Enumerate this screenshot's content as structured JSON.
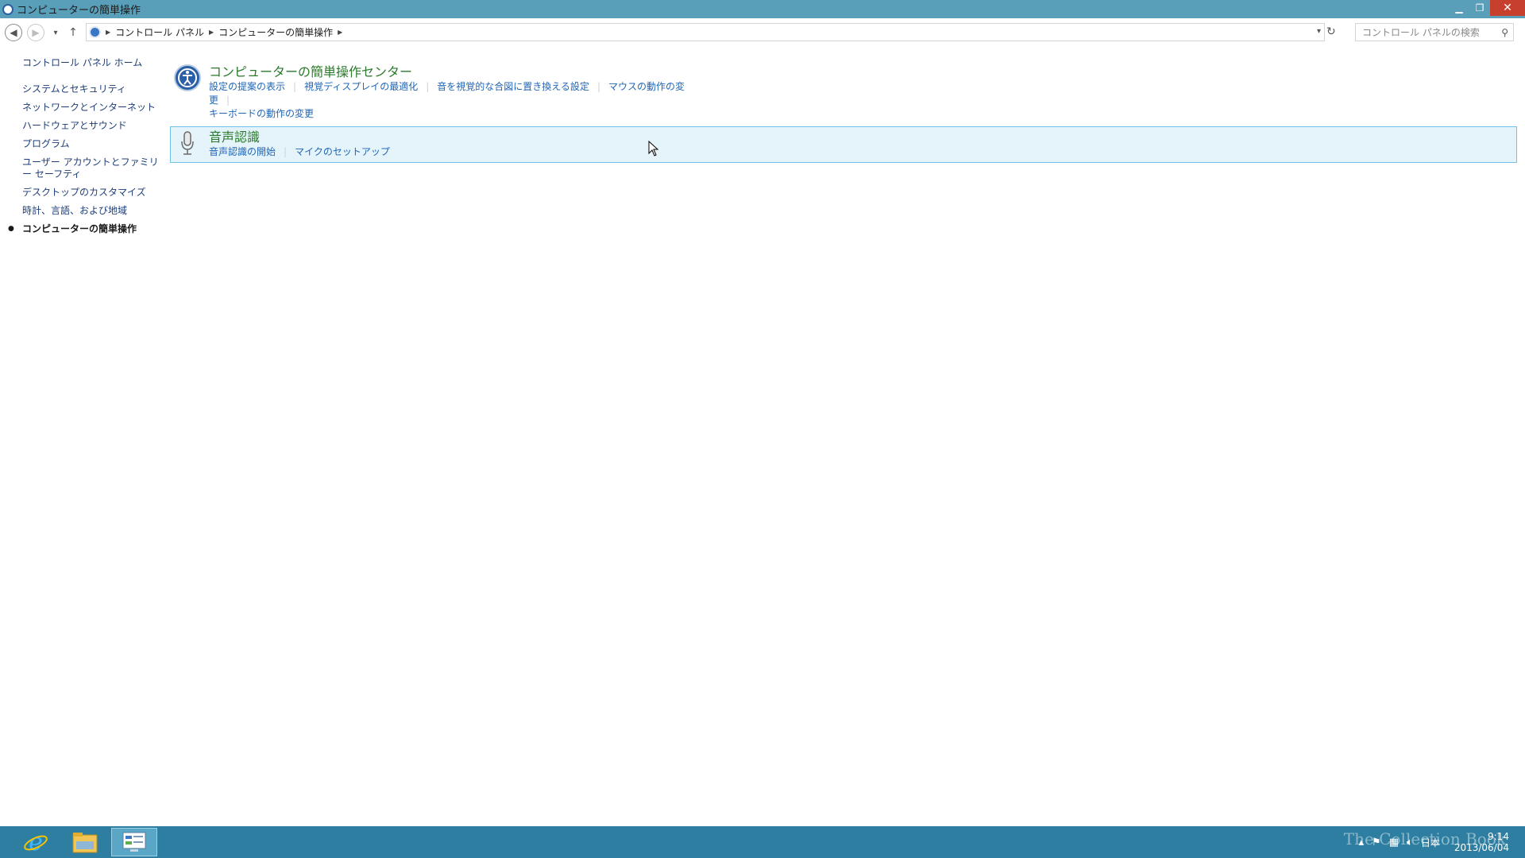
{
  "window": {
    "title": "コンピューターの簡単操作"
  },
  "address": {
    "crumbs": [
      "コントロール パネル",
      "コンピューターの簡単操作"
    ],
    "search_placeholder": "コントロール パネルの検索"
  },
  "sidebar": {
    "home": "コントロール パネル ホーム",
    "items": [
      "システムとセキュリティ",
      "ネットワークとインターネット",
      "ハードウェアとサウンド",
      "プログラム",
      "ユーザー アカウントとファミリー セーフティ",
      "デスクトップのカスタマイズ",
      "時計、言語、および地域",
      "コンピューターの簡単操作"
    ]
  },
  "categories": [
    {
      "title": "コンピューターの簡単操作センター",
      "icon": "ease-of-access-icon",
      "links": [
        "設定の提案の表示",
        "視覚ディスプレイの最適化",
        "音を視覚的な合図に置き換える設定",
        "マウスの動作の変更",
        "キーボードの動作の変更"
      ]
    },
    {
      "title": "音声認識",
      "icon": "microphone-icon",
      "links": [
        "音声認識の開始",
        "マイクのセットアップ"
      ]
    }
  ],
  "taskbar": {
    "apps": [
      "internet-explorer-icon",
      "file-explorer-icon",
      "control-panel-icon"
    ],
    "tray_lang": "日本",
    "time": "9:14",
    "date": "2013/06/04",
    "watermark": "The Collection Book"
  },
  "colors": {
    "titlebar": "#5a9fb9",
    "taskbar": "#2d7ea0",
    "link": "#2166b4",
    "category_title": "#2b7a2b",
    "hover_bg": "#e5f3fb"
  }
}
